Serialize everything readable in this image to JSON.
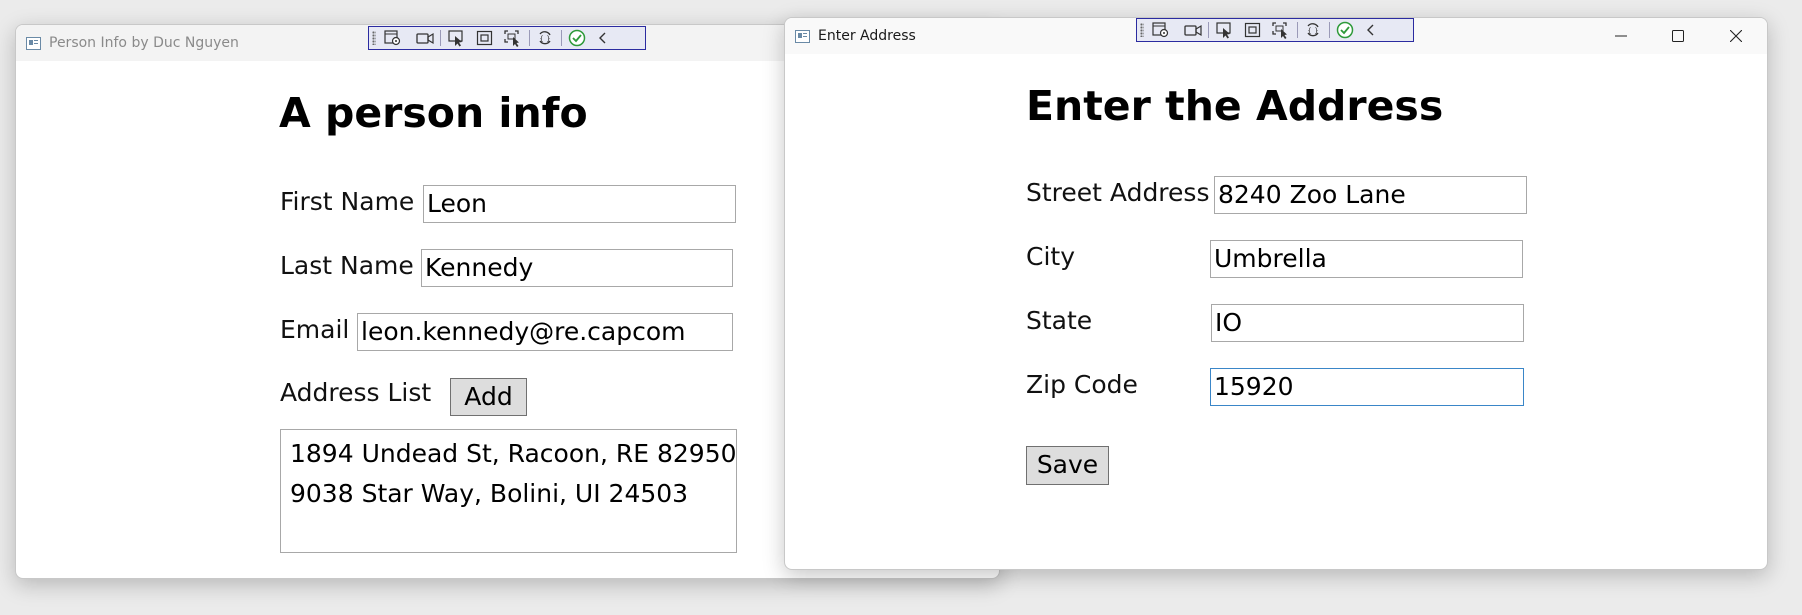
{
  "person_window": {
    "title": "Person Info by Duc Nguyen",
    "heading": "A person info",
    "first_name": {
      "label": "First Name",
      "value": "Leon"
    },
    "last_name": {
      "label": "Last Name",
      "value": "Kennedy"
    },
    "email": {
      "label": "Email",
      "value": "leon.kennedy@re.capcom"
    },
    "address_list": {
      "label": "Address List",
      "add_label": "Add",
      "items": [
        "1894 Undead St, Racoon, RE 82950",
        "9038 Star Way, Bolini, UI 24503"
      ]
    }
  },
  "address_window": {
    "title": "Enter Address",
    "heading": "Enter the Address",
    "street": {
      "label": "Street Address",
      "value": "8240 Zoo Lane"
    },
    "city": {
      "label": "City",
      "value": "Umbrella"
    },
    "state": {
      "label": "State",
      "value": "IO"
    },
    "zip": {
      "label": "Zip Code",
      "value": "15920"
    },
    "save_label": "Save"
  },
  "devtools": {
    "icons": [
      "select-element-icon",
      "video-icon",
      "select-element-pointer-icon",
      "display-layout-adorners-icon",
      "track-focus-icon",
      "hot-reload-icon",
      "binding-failures-check-icon",
      "collapse-toolbar-icon"
    ]
  },
  "colors": {
    "focus_border": "#3a86c8",
    "devbar_border": "#2b2ba0",
    "check_green": "#2e9a3a"
  }
}
